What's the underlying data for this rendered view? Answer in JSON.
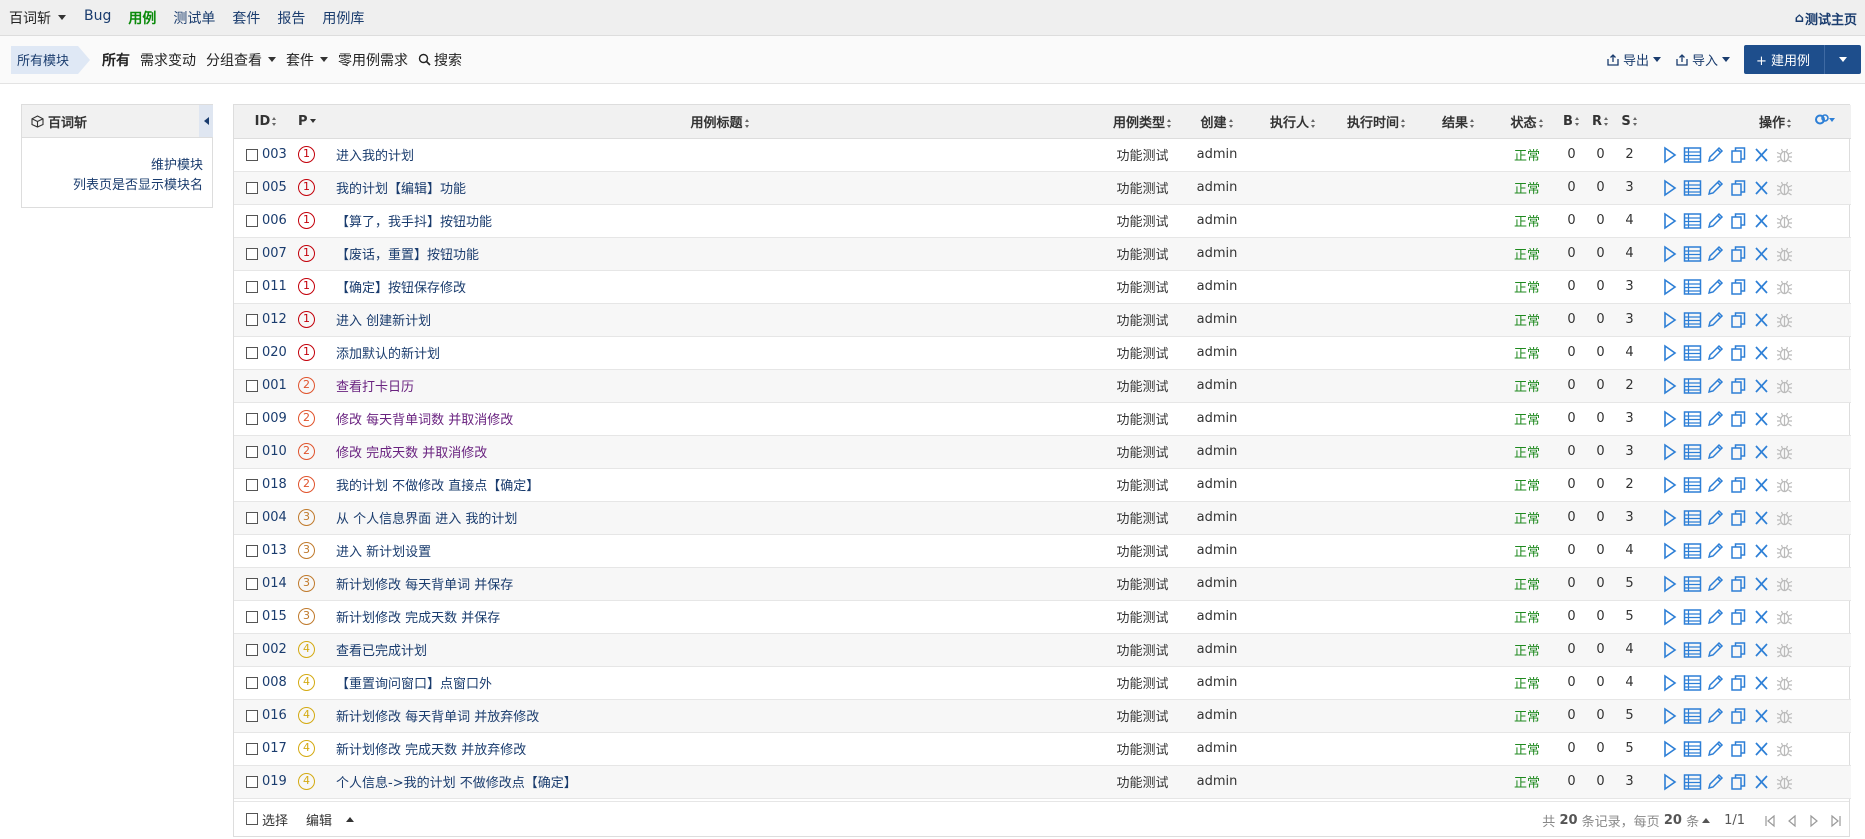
{
  "topnav": {
    "product": "百词斩",
    "menu": [
      {
        "label": "Bug",
        "active": false
      },
      {
        "label": "用例",
        "active": true
      },
      {
        "label": "测试单",
        "active": false
      },
      {
        "label": "套件",
        "active": false
      },
      {
        "label": "报告",
        "active": false
      },
      {
        "label": "用例库",
        "active": false
      }
    ],
    "home": "测试主页"
  },
  "subnav": {
    "module_crumb": "所有模块",
    "features": [
      {
        "label": "所有",
        "active": true,
        "dropdown": false
      },
      {
        "label": "需求变动",
        "active": false,
        "dropdown": false
      },
      {
        "label": "分组查看",
        "active": false,
        "dropdown": true
      },
      {
        "label": "套件",
        "active": false,
        "dropdown": true
      },
      {
        "label": "零用例需求",
        "active": false,
        "dropdown": false
      }
    ],
    "search": "搜索",
    "export": "导出",
    "import": "导入",
    "create": "+ 建用例"
  },
  "sidetree": {
    "title": "百词斩",
    "links": [
      "维护模块",
      "列表页是否显示模块名"
    ]
  },
  "table": {
    "headers": {
      "id": "ID",
      "pri": "P",
      "title": "用例标题",
      "type": "用例类型",
      "creator": "创建",
      "executor": "执行人",
      "exec_time": "执行时间",
      "result": "结果",
      "status": "状态",
      "b": "B",
      "r": "R",
      "s": "S",
      "actions": "操作"
    },
    "rows": [
      {
        "id": "003",
        "pri": "1",
        "title": "进入我的计划",
        "type": "功能测试",
        "creator": "admin",
        "status": "正常",
        "b": "0",
        "r": "0",
        "s": "2",
        "visited": false
      },
      {
        "id": "005",
        "pri": "1",
        "title": "我的计划【编辑】功能",
        "type": "功能测试",
        "creator": "admin",
        "status": "正常",
        "b": "0",
        "r": "0",
        "s": "3",
        "visited": false
      },
      {
        "id": "006",
        "pri": "1",
        "title": "【算了，我手抖】按钮功能",
        "type": "功能测试",
        "creator": "admin",
        "status": "正常",
        "b": "0",
        "r": "0",
        "s": "4",
        "visited": false
      },
      {
        "id": "007",
        "pri": "1",
        "title": "【废话，重置】按钮功能",
        "type": "功能测试",
        "creator": "admin",
        "status": "正常",
        "b": "0",
        "r": "0",
        "s": "4",
        "visited": false
      },
      {
        "id": "011",
        "pri": "1",
        "title": "【确定】按钮保存修改",
        "type": "功能测试",
        "creator": "admin",
        "status": "正常",
        "b": "0",
        "r": "0",
        "s": "3",
        "visited": false
      },
      {
        "id": "012",
        "pri": "1",
        "title": "进入 创建新计划",
        "type": "功能测试",
        "creator": "admin",
        "status": "正常",
        "b": "0",
        "r": "0",
        "s": "3",
        "visited": false
      },
      {
        "id": "020",
        "pri": "1",
        "title": "添加默认的新计划",
        "type": "功能测试",
        "creator": "admin",
        "status": "正常",
        "b": "0",
        "r": "0",
        "s": "4",
        "visited": false
      },
      {
        "id": "001",
        "pri": "2",
        "title": "查看打卡日历",
        "type": "功能测试",
        "creator": "admin",
        "status": "正常",
        "b": "0",
        "r": "0",
        "s": "2",
        "visited": true
      },
      {
        "id": "009",
        "pri": "2",
        "title": "修改 每天背单词数 并取消修改",
        "type": "功能测试",
        "creator": "admin",
        "status": "正常",
        "b": "0",
        "r": "0",
        "s": "3",
        "visited": true
      },
      {
        "id": "010",
        "pri": "2",
        "title": "修改 完成天数 并取消修改",
        "type": "功能测试",
        "creator": "admin",
        "status": "正常",
        "b": "0",
        "r": "0",
        "s": "3",
        "visited": true
      },
      {
        "id": "018",
        "pri": "2",
        "title": "我的计划 不做修改 直接点【确定】",
        "type": "功能测试",
        "creator": "admin",
        "status": "正常",
        "b": "0",
        "r": "0",
        "s": "2",
        "visited": false
      },
      {
        "id": "004",
        "pri": "3",
        "title": "从 个人信息界面 进入 我的计划",
        "type": "功能测试",
        "creator": "admin",
        "status": "正常",
        "b": "0",
        "r": "0",
        "s": "3",
        "visited": false
      },
      {
        "id": "013",
        "pri": "3",
        "title": "进入 新计划设置",
        "type": "功能测试",
        "creator": "admin",
        "status": "正常",
        "b": "0",
        "r": "0",
        "s": "4",
        "visited": false
      },
      {
        "id": "014",
        "pri": "3",
        "title": "新计划修改 每天背单词 并保存",
        "type": "功能测试",
        "creator": "admin",
        "status": "正常",
        "b": "0",
        "r": "0",
        "s": "5",
        "visited": false
      },
      {
        "id": "015",
        "pri": "3",
        "title": "新计划修改 完成天数 并保存",
        "type": "功能测试",
        "creator": "admin",
        "status": "正常",
        "b": "0",
        "r": "0",
        "s": "5",
        "visited": false
      },
      {
        "id": "002",
        "pri": "4",
        "title": "查看已完成计划",
        "type": "功能测试",
        "creator": "admin",
        "status": "正常",
        "b": "0",
        "r": "0",
        "s": "4",
        "visited": false
      },
      {
        "id": "008",
        "pri": "4",
        "title": "【重置询问窗口】点窗口外",
        "type": "功能测试",
        "creator": "admin",
        "status": "正常",
        "b": "0",
        "r": "0",
        "s": "4",
        "visited": false
      },
      {
        "id": "016",
        "pri": "4",
        "title": "新计划修改 每天背单词 并放弃修改",
        "type": "功能测试",
        "creator": "admin",
        "status": "正常",
        "b": "0",
        "r": "0",
        "s": "5",
        "visited": false
      },
      {
        "id": "017",
        "pri": "4",
        "title": "新计划修改 完成天数 并放弃修改",
        "type": "功能测试",
        "creator": "admin",
        "status": "正常",
        "b": "0",
        "r": "0",
        "s": "5",
        "visited": false
      },
      {
        "id": "019",
        "pri": "4",
        "title": "个人信息->我的计划 不做修改点【确定】",
        "type": "功能测试",
        "creator": "admin",
        "status": "正常",
        "b": "0",
        "r": "0",
        "s": "3",
        "visited": false
      }
    ]
  },
  "footer": {
    "select": "选择",
    "edit": "编辑",
    "pager_prefix": "共",
    "total": "20",
    "pager_mid": "条记录，每页",
    "per_page": "20",
    "pager_suffix": "条",
    "page": "1/1"
  },
  "colors": {
    "accent": "#1e4e8c",
    "link": "#1a3c6e",
    "status_ok": "#1f8a1f",
    "pri1": "#c3000a",
    "pri2": "#e0532c",
    "pri3": "#c07a2c",
    "pri4": "#d4aa12",
    "action_icon": "#2d7fd6"
  },
  "icons": {
    "row_actions": [
      "run-icon",
      "results-icon",
      "edit-icon",
      "copy-icon",
      "delete-icon",
      "bug-icon"
    ]
  }
}
